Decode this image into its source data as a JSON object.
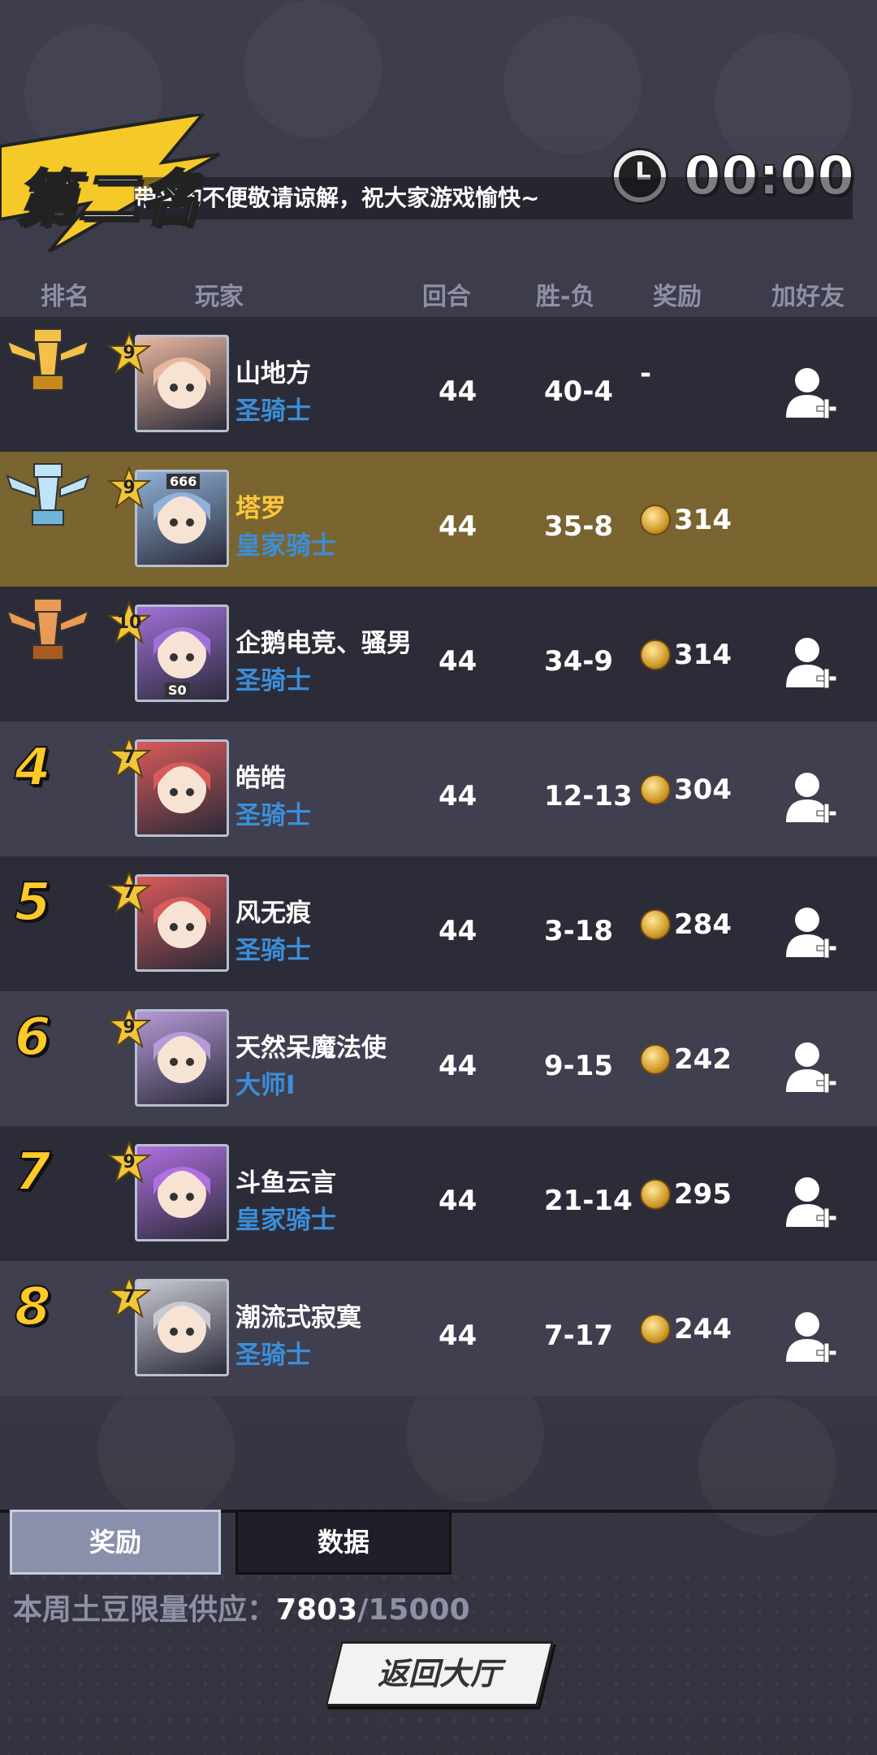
{
  "header": {
    "banner_title": "第二名",
    "marquee": "带来的不便敬请谅解，祝大家游戏愉快~",
    "timer": "00:00"
  },
  "columns": [
    "排名",
    "玩家",
    "回合",
    "胜-负",
    "奖励",
    "加好友"
  ],
  "rows": [
    {
      "rank": "1",
      "trophy": "gold-trophy-icon",
      "level": "9",
      "name": "山地方",
      "title": "圣骑士",
      "rounds": "44",
      "record": "40-4",
      "reward": "-",
      "add_friend": true
    },
    {
      "rank": "2",
      "trophy": "silver-trophy-icon",
      "level": "9",
      "name": "塔罗",
      "title": "皇家骑士",
      "rounds": "44",
      "record": "35-8",
      "reward": "314",
      "add_friend": false,
      "avatar_tag": "666"
    },
    {
      "rank": "3",
      "trophy": "bronze-trophy-icon",
      "level": "10",
      "name": "企鹅电竞、骚男",
      "title": "圣骑士",
      "rounds": "44",
      "record": "34-9",
      "reward": "314",
      "add_friend": true,
      "avatar_tag": "S0"
    },
    {
      "rank": "4",
      "level": "7",
      "name": "皓皓",
      "title": "圣骑士",
      "rounds": "44",
      "record": "12-13",
      "reward": "304",
      "add_friend": true
    },
    {
      "rank": "5",
      "level": "7",
      "name": "风无痕",
      "title": "圣骑士",
      "rounds": "44",
      "record": "3-18",
      "reward": "284",
      "add_friend": true
    },
    {
      "rank": "6",
      "level": "9",
      "name": "天然呆魔法使",
      "title": "大师I",
      "rounds": "44",
      "record": "9-15",
      "reward": "242",
      "add_friend": true
    },
    {
      "rank": "7",
      "level": "9",
      "name": "斗鱼云言",
      "title": "皇家骑士",
      "rounds": "44",
      "record": "21-14",
      "reward": "295",
      "add_friend": true
    },
    {
      "rank": "8",
      "level": "7",
      "name": "潮流式寂寞",
      "title": "圣骑士",
      "rounds": "44",
      "record": "7-17",
      "reward": "244",
      "add_friend": true
    }
  ],
  "tabs": {
    "reward": "奖励",
    "data": "数据"
  },
  "supply": {
    "label": "本周土豆限量供应：",
    "current": "7803",
    "max": "/15000"
  },
  "back_button": "返回大厅",
  "colors": {
    "accent_gold": "#ffc928",
    "title_blue": "#3b8ed9",
    "highlight_row": "#7a6530"
  }
}
